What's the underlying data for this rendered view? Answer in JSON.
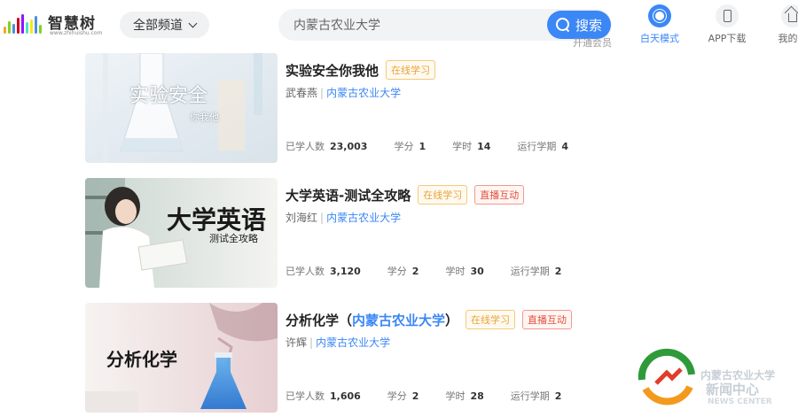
{
  "header": {
    "logo_text": "智慧树",
    "logo_subtext": "www.zhihuishu.com",
    "channel_label": "全部频道",
    "search_value": "内蒙古农业大学",
    "search_button": "搜索",
    "vip_peek": "开通会员",
    "nav": [
      {
        "label": "白天模式",
        "icon": "sun-mode-icon"
      },
      {
        "label": "APP下载",
        "icon": "phone-icon"
      },
      {
        "label": "我的学",
        "icon": "home-icon"
      }
    ]
  },
  "courses": [
    {
      "title": "实验安全你我他",
      "school_in_title": "",
      "tags": [
        "在线学习"
      ],
      "teacher": "武春燕",
      "school": "内蒙古农业大学",
      "stats": {
        "students_label": "已学人数",
        "students": "23,003",
        "credit_label": "学分",
        "credit": "1",
        "hours_label": "学时",
        "hours": "14",
        "terms_label": "运行学期",
        "terms": "4"
      },
      "thumb_caption": "实验安全",
      "thumb_sub": "你我他"
    },
    {
      "title": "大学英语-测试全攻略",
      "school_in_title": "",
      "tags": [
        "在线学习",
        "直播互动"
      ],
      "teacher": "刘海红",
      "school": "内蒙古农业大学",
      "stats": {
        "students_label": "已学人数",
        "students": "3,120",
        "credit_label": "学分",
        "credit": "2",
        "hours_label": "学时",
        "hours": "30",
        "terms_label": "运行学期",
        "terms": "2"
      },
      "thumb_caption": "大学英语",
      "thumb_sub": "测试全攻略"
    },
    {
      "title": "分析化学（",
      "school_in_title": "内蒙古农业大学",
      "title_suffix": "）",
      "tags": [
        "在线学习",
        "直播互动"
      ],
      "teacher": "许辉",
      "school": "内蒙古农业大学",
      "stats": {
        "students_label": "已学人数",
        "students": "1,606",
        "credit_label": "学分",
        "credit": "2",
        "hours_label": "学时",
        "hours": "28",
        "terms_label": "运行学期",
        "terms": "2"
      },
      "thumb_caption": "分析化学"
    }
  ],
  "news_badge": {
    "line1": "内蒙古农业大学",
    "line2": "新闻中心",
    "line3": "NEWS CENTER"
  },
  "colors": {
    "accent": "#3b87f5",
    "online_tag": "#e8a33a",
    "live_tag": "#e2503d"
  }
}
